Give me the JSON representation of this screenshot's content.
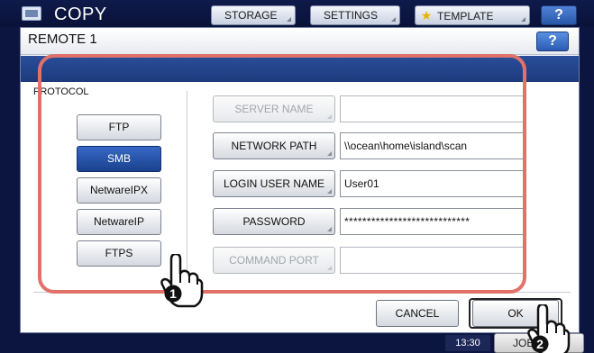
{
  "app": {
    "title": "COPY",
    "tabs": [
      {
        "label": "STORAGE"
      },
      {
        "label": "SETTINGS"
      },
      {
        "label": "TEMPLATE"
      }
    ],
    "help_label": "?",
    "clock": "13:30",
    "jobs_label": "JOB S"
  },
  "dialog": {
    "title": "REMOTE 1",
    "help_label": "?",
    "protocol_label": "PROTOCOL",
    "protocols": [
      {
        "label": "FTP",
        "selected": false
      },
      {
        "label": "SMB",
        "selected": true
      },
      {
        "label": "NetwareIPX",
        "selected": false
      },
      {
        "label": "NetwareIP",
        "selected": false
      },
      {
        "label": "FTPS",
        "selected": false
      }
    ],
    "fields": [
      {
        "label": "SERVER NAME",
        "value": "",
        "enabled": false
      },
      {
        "label": "NETWORK PATH",
        "value": "\\\\ocean\\home\\island\\scan",
        "enabled": true
      },
      {
        "label": "LOGIN USER NAME",
        "value": "User01",
        "enabled": true
      },
      {
        "label": "PASSWORD",
        "value": "****************************",
        "enabled": true
      },
      {
        "label": "COMMAND PORT",
        "value": "",
        "enabled": false
      }
    ],
    "cancel_label": "CANCEL",
    "ok_label": "OK"
  },
  "annotations": {
    "step1": "1",
    "step2": "2",
    "highlight_color": "#e0726a"
  },
  "colors": {
    "selected_button": "#1b418d",
    "band": "#1d3a7c",
    "dark_frame": "#0c1540"
  }
}
